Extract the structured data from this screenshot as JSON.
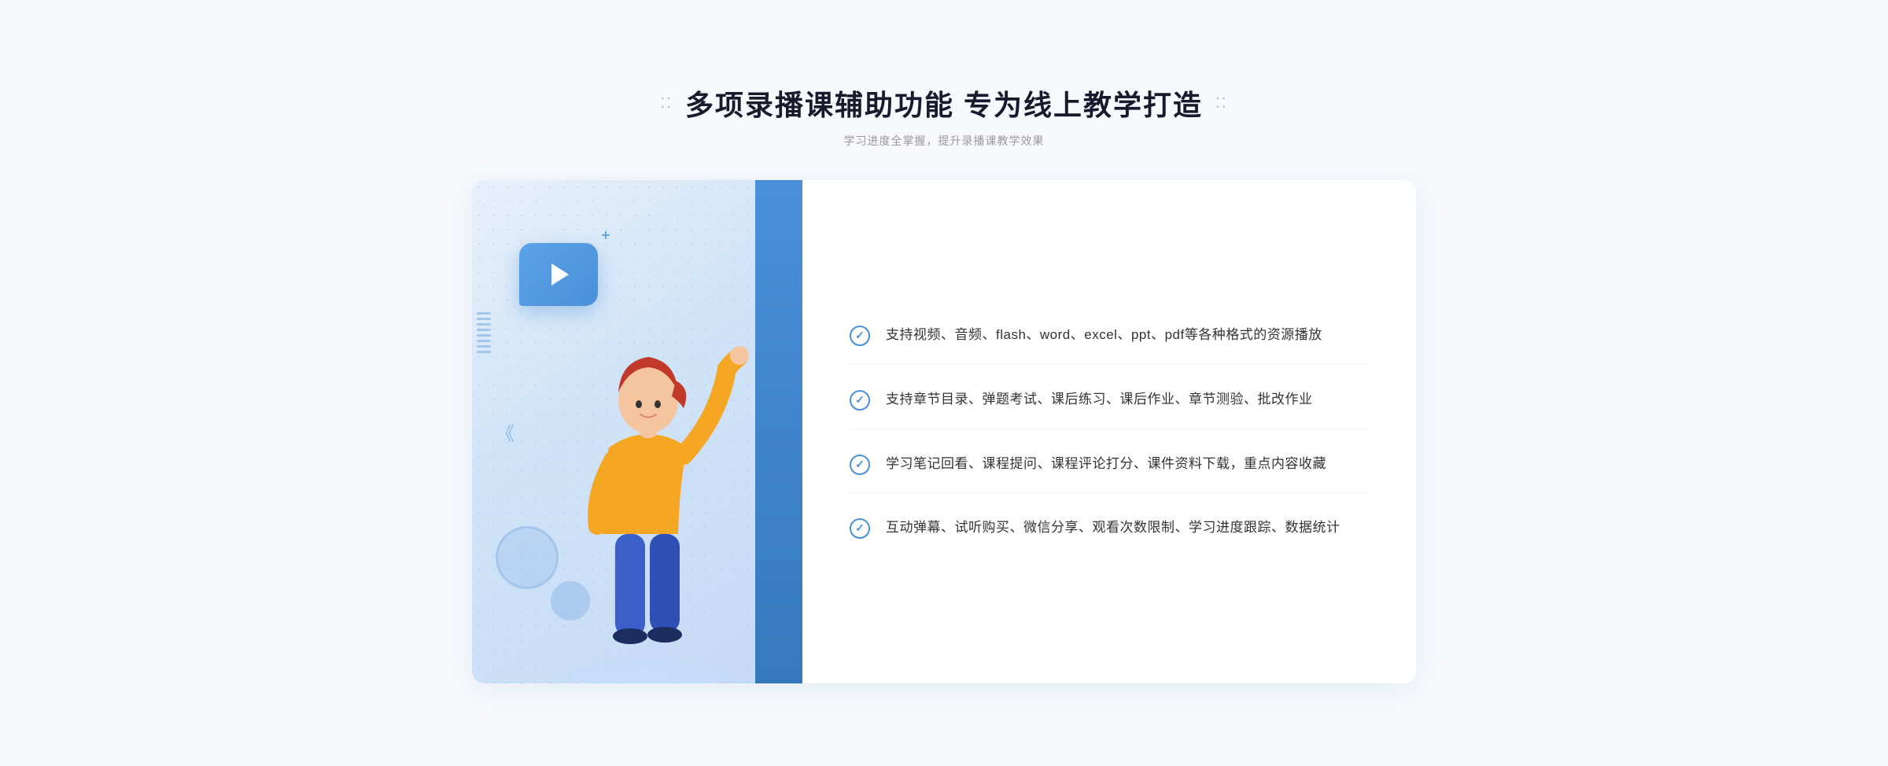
{
  "header": {
    "title": "多项录播课辅助功能 专为线上教学打造",
    "subtitle": "学习进度全掌握，提升录播课教学效果",
    "title_dots_left": "⁚⁚",
    "title_dots_right": "⁚⁚"
  },
  "features": [
    {
      "id": 1,
      "text": "支持视频、音频、flash、word、excel、ppt、pdf等各种格式的资源播放"
    },
    {
      "id": 2,
      "text": "支持章节目录、弹题考试、课后练习、课后作业、章节测验、批改作业"
    },
    {
      "id": 3,
      "text": "学习笔记回看、课程提问、课程评论打分、课件资料下载，重点内容收藏"
    },
    {
      "id": 4,
      "text": "互动弹幕、试听购买、微信分享、观看次数限制、学习进度跟踪、数据统计"
    }
  ],
  "colors": {
    "primary": "#4a90d9",
    "title": "#1a1a2e",
    "text": "#333333",
    "subtitle": "#999999",
    "border": "#f0f4f8"
  },
  "outside_chevron": "»"
}
